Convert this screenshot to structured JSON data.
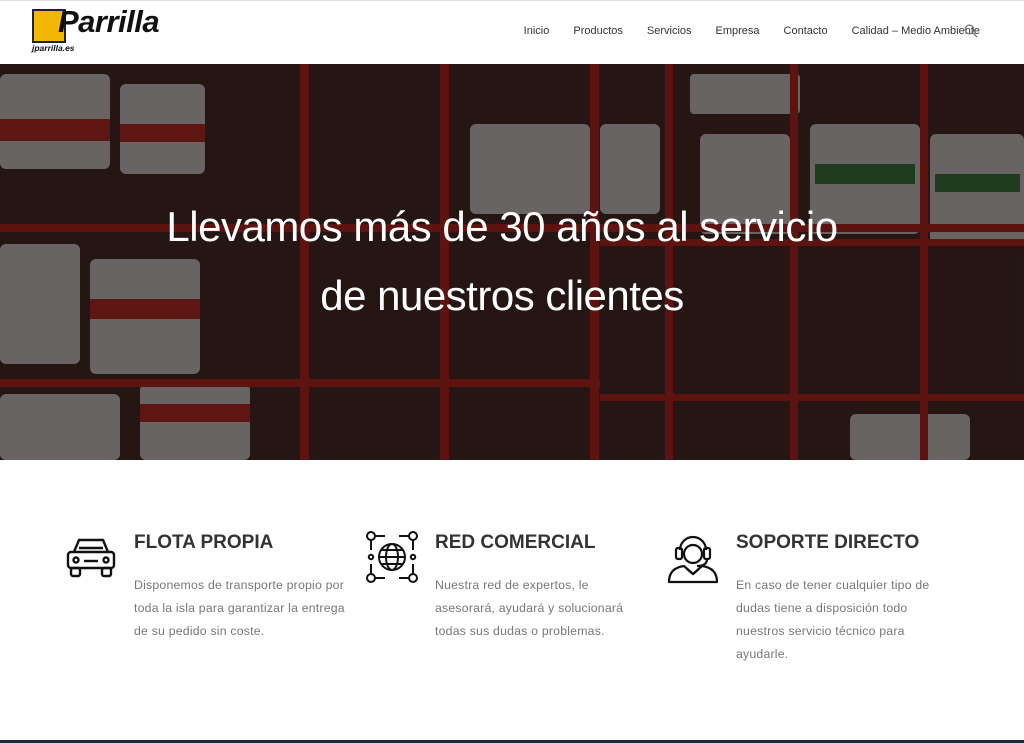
{
  "brand": {
    "logo_word": "Parrilla",
    "logo_sub": "jparrilla.es"
  },
  "nav": {
    "items": [
      {
        "label": "Inicio"
      },
      {
        "label": "Productos"
      },
      {
        "label": "Servicios"
      },
      {
        "label": "Empresa"
      },
      {
        "label": "Contacto"
      },
      {
        "label": "Calidad – Medio Ambiente"
      }
    ],
    "search_icon": "search-icon"
  },
  "hero": {
    "line1": "Llevamos más de 30 años al servicio",
    "line2": "de nuestros clientes"
  },
  "features": [
    {
      "icon": "car-icon",
      "title": "FLOTA PROPIA",
      "text": "Disponemos de transporte propio por toda la isla para garantizar la entrega de su pedido sin coste."
    },
    {
      "icon": "network-globe-icon",
      "title": "RED COMERCIAL",
      "text": "Nuestra red de expertos, le asesorará, ayudará y solucionará todas sus dudas o problemas."
    },
    {
      "icon": "headset-support-icon",
      "title": "SOPORTE DIRECTO",
      "text": "En caso de tener cualquier tipo de dudas tiene a disposición todo nuestros servicio técnico para ayudarle."
    }
  ],
  "colors": {
    "logo_yellow": "#f2b705",
    "text_dark": "#333333",
    "text_muted": "#777777",
    "footer": "#1d2b3a"
  }
}
